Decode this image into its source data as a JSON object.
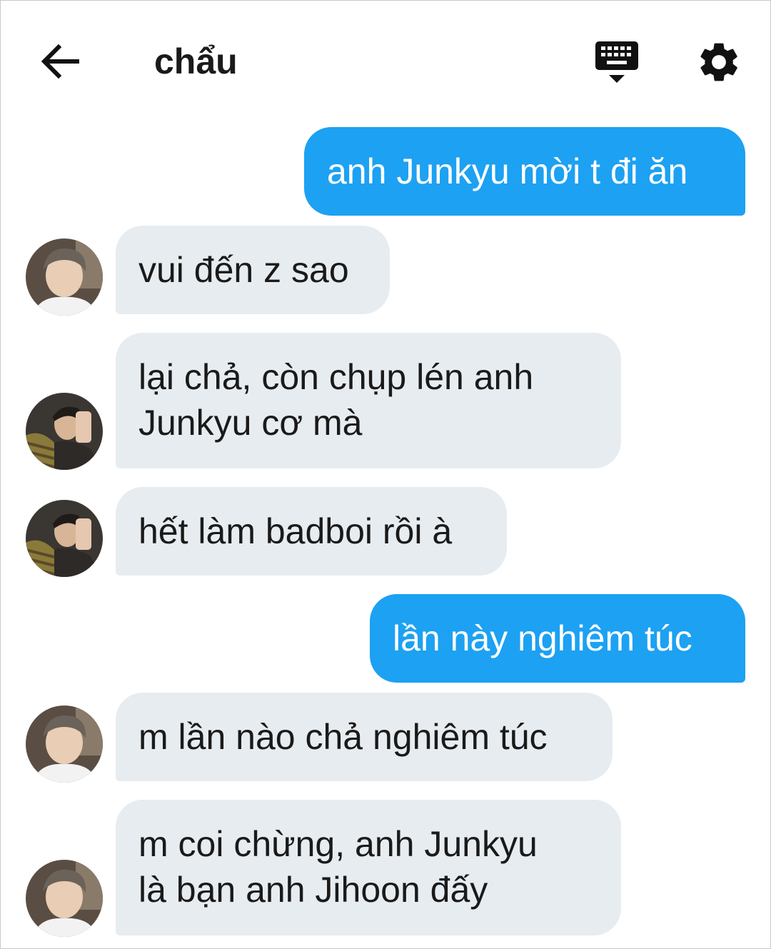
{
  "header": {
    "title": "chẩu",
    "back_icon": "arrow-left-icon",
    "keyboard_icon": "keyboard-hide-icon",
    "settings_icon": "gear-icon"
  },
  "colors": {
    "outgoing_bubble": "#1da1f2",
    "incoming_bubble": "#e7ecf0",
    "text": "#1a1a1a"
  },
  "messages": [
    {
      "direction": "out",
      "text": "anh Junkyu mời t đi ăn"
    },
    {
      "direction": "in",
      "avatar": "boy-white-shirt",
      "text": "vui đến z sao"
    },
    {
      "direction": "in",
      "avatar": "couple-selfie",
      "lines": [
        "lại chả, còn chụp lén anh",
        "Junkyu cơ mà"
      ]
    },
    {
      "direction": "in",
      "avatar": "couple-selfie",
      "text": "hết làm badboi rồi à"
    },
    {
      "direction": "out",
      "text": "lần này nghiêm túc"
    },
    {
      "direction": "in",
      "avatar": "boy-white-shirt",
      "text": "m lần nào chả nghiêm túc"
    },
    {
      "direction": "in",
      "avatar": "boy-white-shirt",
      "lines": [
        "m coi chừng, anh Junkyu",
        "là bạn anh Jihoon đấy"
      ]
    }
  ]
}
